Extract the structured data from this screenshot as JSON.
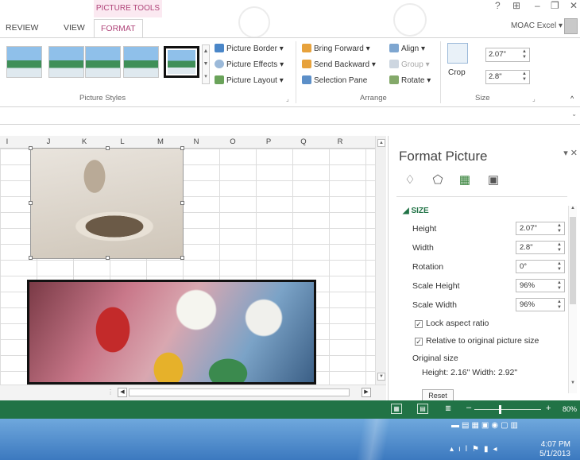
{
  "ribbon_tabs": {
    "context_title": "PICTURE TOOLS",
    "review": "REVIEW",
    "view": "VIEW",
    "format": "FORMAT"
  },
  "window": {
    "help": "?",
    "ribbon_display": "⊞",
    "minimize": "–",
    "restore": "❐",
    "close": "✕",
    "user": "MOAC Excel ▾"
  },
  "ribbon": {
    "picture_border": "Picture Border ▾",
    "picture_effects": "Picture Effects ▾",
    "picture_layout": "Picture Layout ▾",
    "picture_styles_label": "Picture Styles",
    "bring_forward": "Bring Forward ▾",
    "send_backward": "Send Backward ▾",
    "selection_pane": "Selection Pane",
    "align": "Align ▾",
    "group": "Group ▾",
    "rotate": "Rotate ▾",
    "arrange_label": "Arrange",
    "crop": "Crop",
    "height_value": "2.07\"",
    "width_value": "2.8\"",
    "size_label": "Size",
    "launcher": "⌟"
  },
  "columns": [
    "I",
    "J",
    "K",
    "L",
    "M",
    "N",
    "O",
    "P",
    "Q",
    "R"
  ],
  "pane": {
    "title": "Format Picture",
    "close": "▾ ✕",
    "section": "◢ SIZE",
    "height_label": "Height",
    "height_value": "2.07\"",
    "width_label": "Width",
    "width_value": "2.8\"",
    "rotation_label": "Rotation",
    "rotation_value": "0°",
    "scale_height_label": "Scale Height",
    "scale_height_value": "96%",
    "scale_width_label": "Scale Width",
    "scale_width_value": "96%",
    "lock_aspect": "Lock aspect ratio",
    "relative_original": "Relative to original picture size",
    "original_size": "Original size",
    "original_dims": "Height:  2.16\"   Width:  2.92\"",
    "reset": "Reset"
  },
  "status": {
    "zoom": "80%",
    "minus": "–",
    "plus": "+"
  },
  "taskbar": {
    "time": "4:07 PM",
    "date": "5/1/2013"
  },
  "colors": {
    "accent": "#217346",
    "context_tab": "#b0457a"
  }
}
